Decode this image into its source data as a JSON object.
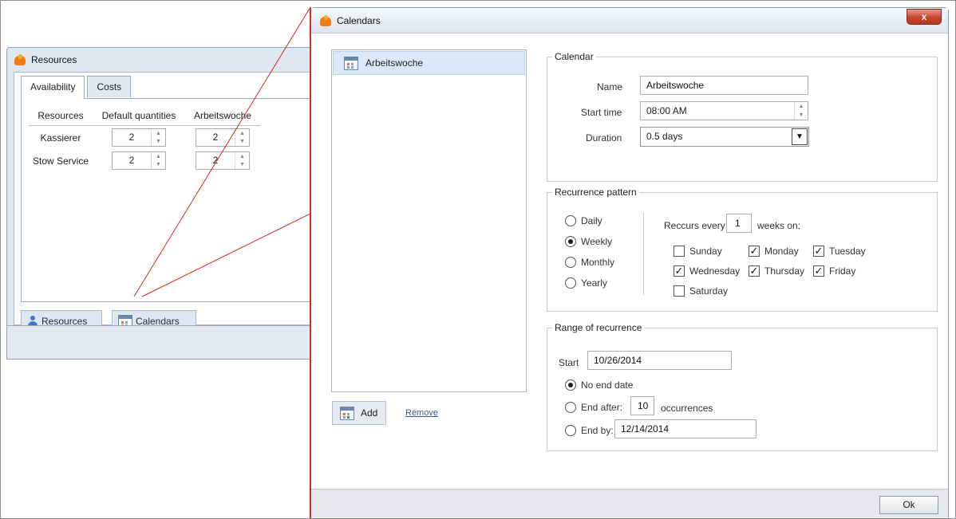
{
  "resources_window": {
    "title": "Resources",
    "tabs": [
      {
        "label": "Availability"
      },
      {
        "label": "Costs"
      }
    ],
    "table": {
      "headers": [
        "Resources",
        "Default quantities",
        "Arbeitswoche"
      ],
      "rows": [
        {
          "name": "Kassierer",
          "default_qty": "2",
          "calendar_qty": "2"
        },
        {
          "name": "Stow Service",
          "default_qty": "2",
          "calendar_qty": "2"
        }
      ]
    },
    "buttons": {
      "resources_label": "Resources",
      "calendars_label": "Calendars"
    }
  },
  "calendars_dialog": {
    "title": "Calendars",
    "close_glyph": "x",
    "list": {
      "items": [
        {
          "label": "Arbeitswoche"
        }
      ]
    },
    "add_label": "Add",
    "remove_label": "Remove",
    "calendar_group": {
      "legend": "Calendar",
      "name_label": "Name",
      "name_value": "Arbeitswoche",
      "start_label": "Start time",
      "start_value": "08:00 AM",
      "duration_label": "Duration",
      "duration_value": "0.5 days"
    },
    "recurrence_group": {
      "legend": "Recurrence pattern",
      "patterns": [
        {
          "label": "Daily",
          "selected": false
        },
        {
          "label": "Weekly",
          "selected": true
        },
        {
          "label": "Monthly",
          "selected": false
        },
        {
          "label": "Yearly",
          "selected": false
        }
      ],
      "every_prefix": "Reccurs every",
      "every_value": "1",
      "every_suffix": "weeks on:",
      "days": {
        "sunday": {
          "label": "Sunday",
          "checked": false
        },
        "monday": {
          "label": "Monday",
          "checked": true
        },
        "tuesday": {
          "label": "Tuesday",
          "checked": true
        },
        "wednesday": {
          "label": "Wednesday",
          "checked": true
        },
        "thursday": {
          "label": "Thursday",
          "checked": true
        },
        "friday": {
          "label": "Friday",
          "checked": true
        },
        "saturday": {
          "label": "Saturday",
          "checked": false
        }
      }
    },
    "range_group": {
      "legend": "Range of recurrence",
      "start_label": "Start",
      "start_value": "10/26/2014",
      "no_end_label": "No end date",
      "end_after_label": "End after:",
      "end_after_value": "10",
      "occurrences_label": "occurrences",
      "end_by_label": "End by:",
      "end_by_value": "12/14/2014",
      "selected": "no_end"
    },
    "ok_label": "Ok"
  },
  "colors": {
    "accent_line": "#e02424",
    "window_frame": "#8ea2bb",
    "selection": "#dbe8f8"
  }
}
